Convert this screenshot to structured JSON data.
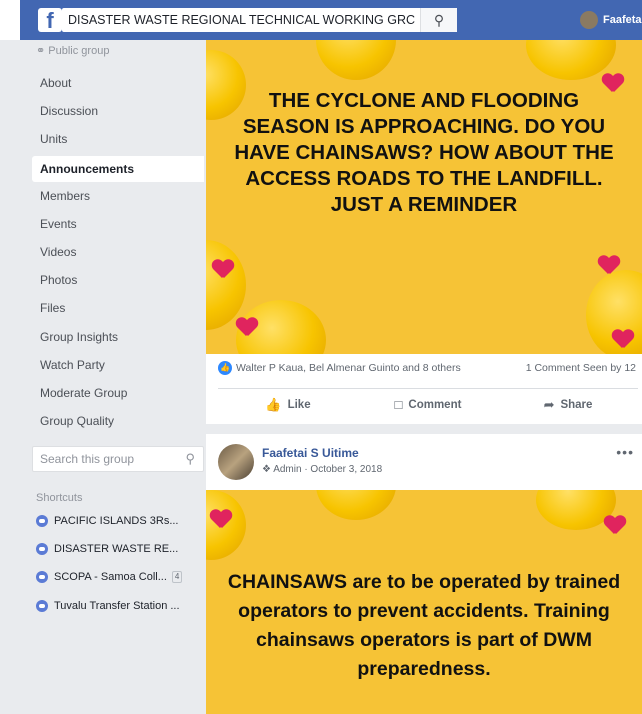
{
  "topbar": {
    "search_value": "DISASTER WASTE REGIONAL TECHNICAL WORKING GRC",
    "user_name": "Faafetai"
  },
  "sidebar": {
    "privacy": "Public group",
    "items": [
      {
        "label": "About",
        "active": false
      },
      {
        "label": "Discussion",
        "active": false
      },
      {
        "label": "Units",
        "active": false
      },
      {
        "label": "Announcements",
        "active": true
      },
      {
        "label": "Members",
        "active": false
      },
      {
        "label": "Events",
        "active": false
      },
      {
        "label": "Videos",
        "active": false
      },
      {
        "label": "Photos",
        "active": false
      },
      {
        "label": "Files",
        "active": false
      },
      {
        "label": "Group Insights",
        "active": false
      },
      {
        "label": "Watch Party",
        "active": false
      },
      {
        "label": "Moderate Group",
        "active": false
      },
      {
        "label": "Group Quality",
        "active": false
      }
    ],
    "search_placeholder": "Search this group",
    "shortcuts_title": "Shortcuts",
    "shortcuts": [
      {
        "label": "PACIFIC ISLANDS 3Rs...",
        "badge": ""
      },
      {
        "label": "DISASTER WASTE RE...",
        "badge": ""
      },
      {
        "label": "SCOPA - Samoa Coll...",
        "badge": "4"
      },
      {
        "label": "Tuvalu Transfer Station ...",
        "badge": ""
      }
    ]
  },
  "posts": [
    {
      "image_text": "THE CYCLONE AND FLOODING SEASON IS APPROACHING. DO YOU HAVE CHAINSAWS? HOW ABOUT THE ACCESS ROADS TO THE LANDFILL. JUST A REMINDER",
      "reactions": "Walter P Kaua, Bel Almenar Guinto and 8 others",
      "stats": "1 Comment  Seen by 12",
      "actions": {
        "like": "Like",
        "comment": "Comment",
        "share": "Share"
      }
    },
    {
      "author": "Faafetai S Uitime",
      "meta": "Admin · October 3, 2018",
      "image_text": "CHAINSAWS are to be operated by trained operators to prevent accidents. Training chainsaws operators is part of DWM preparedness."
    }
  ],
  "colors": {
    "brand_blue": "#4267b2",
    "post_bg_yellow": "#f6c336",
    "heart_red": "#e0245e"
  }
}
